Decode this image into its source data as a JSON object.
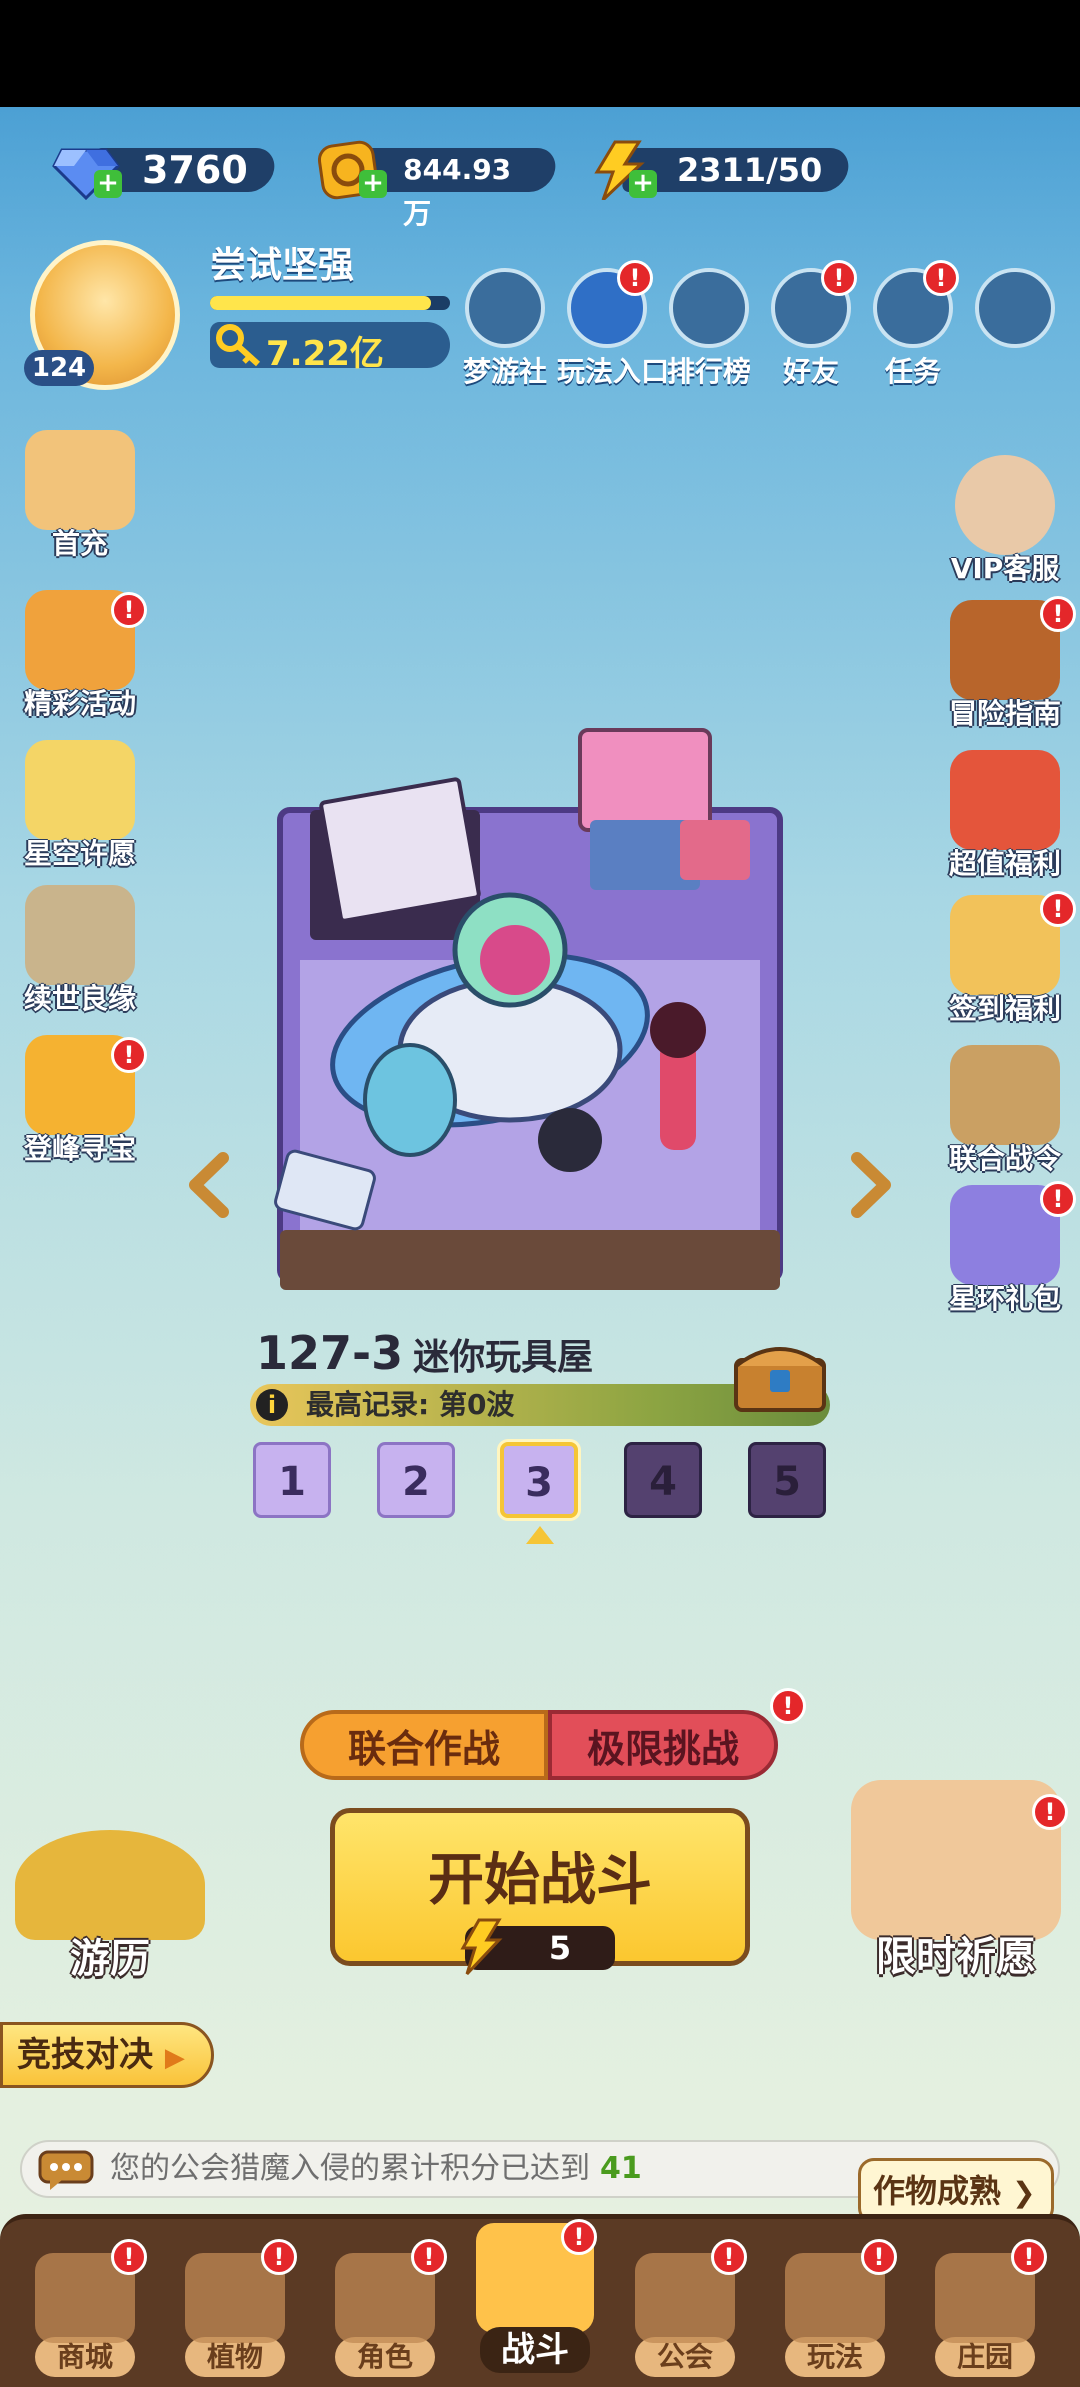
{
  "currencies": {
    "diamonds": "3760",
    "gold": "844.93万",
    "energy": "2311/50"
  },
  "player": {
    "name": "尝试坚强",
    "level": "124",
    "power": "7.22亿",
    "xp_fraction": 0.92
  },
  "top_icons": [
    {
      "label": "梦游社",
      "badge": false
    },
    {
      "label": "玩法入口",
      "badge": true
    },
    {
      "label": "排行榜",
      "badge": false
    },
    {
      "label": "好友",
      "badge": true
    },
    {
      "label": "任务",
      "badge": true
    },
    {
      "label": "",
      "badge": false
    }
  ],
  "left_menu": [
    {
      "label": "首充",
      "badge": false
    },
    {
      "label": "精彩活动",
      "badge": true
    },
    {
      "label": "星空许愿",
      "badge": false
    },
    {
      "label": "续世良缘",
      "badge": false
    },
    {
      "label": "登峰寻宝",
      "badge": true
    }
  ],
  "right_menu": [
    {
      "label": "VIP客服",
      "badge": false
    },
    {
      "label": "冒险指南",
      "badge": true
    },
    {
      "label": "超值福利",
      "badge": false
    },
    {
      "label": "签到福利",
      "badge": true
    },
    {
      "label": "联合战令",
      "badge": false
    },
    {
      "label": "星环礼包",
      "badge": true
    }
  ],
  "level": {
    "code": "127-3",
    "name": "迷你玩具屋",
    "record_label": "最高记录: 第0波",
    "stages": [
      "1",
      "2",
      "3",
      "4",
      "5"
    ],
    "selected_stage": "3"
  },
  "modes": {
    "coop": "联合作战",
    "challenge": "极限挑战"
  },
  "start": {
    "label": "开始战斗",
    "cost": "5"
  },
  "side_buttons": {
    "travel": "游历",
    "wish": "限时祈愿",
    "pvp": "竞技对决"
  },
  "notice": {
    "text": "您的公会猎魔入侵的累计积分已达到",
    "value": "41"
  },
  "crop_ready": "作物成熟",
  "nav": [
    {
      "label": "商城",
      "badge": true
    },
    {
      "label": "植物",
      "badge": true
    },
    {
      "label": "角色",
      "badge": true
    },
    {
      "label": "战斗",
      "badge": true
    },
    {
      "label": "公会",
      "badge": true
    },
    {
      "label": "玩法",
      "badge": true
    },
    {
      "label": "庄园",
      "badge": true
    }
  ],
  "colors": {
    "badge_red": "#e4272a",
    "gold_yellow": "#ffe44a",
    "start_button": "#fbc72f",
    "coop_orange": "#f6a030",
    "challenge_red": "#e24e59",
    "nav_brown": "#5b3a24"
  }
}
